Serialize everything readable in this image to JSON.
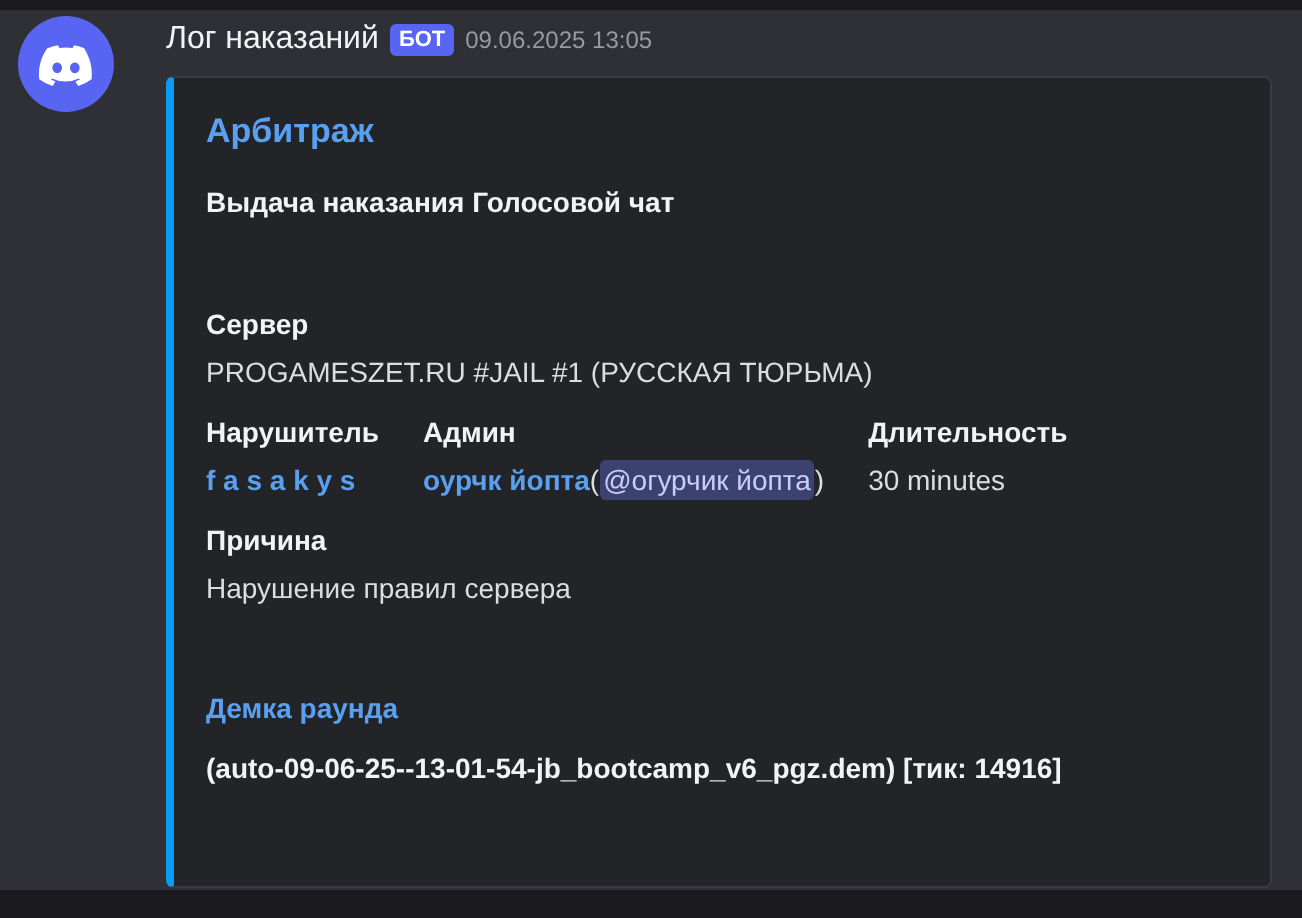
{
  "message": {
    "author": "Лог наказаний",
    "badge": "БОТ",
    "timestamp": "09.06.2025 13:05"
  },
  "embed": {
    "title": "Арбитраж",
    "description": "Выдача наказания Голосовой чат",
    "rows": [
      {
        "kind": "spacer"
      },
      {
        "kind": "fields",
        "fields": [
          {
            "name": "Сервер",
            "name_link": false,
            "values": [
              {
                "kind": "plain",
                "text": "PROGAMESZET.RU #JAIL #1 (РУССКАЯ ТЮРЬМА)"
              }
            ]
          }
        ]
      },
      {
        "kind": "fields",
        "fields": [
          {
            "name": "Нарушитель",
            "name_link": false,
            "values": [
              {
                "kind": "link",
                "text": "f a s a k y s"
              }
            ]
          },
          {
            "name": "Админ",
            "name_link": false,
            "values": [
              {
                "kind": "link",
                "text": "оурчк йопта"
              },
              {
                "kind": "plain",
                "text": "("
              },
              {
                "kind": "mention",
                "text": "@огурчик йопта"
              },
              {
                "kind": "plain",
                "text": ")"
              }
            ]
          },
          {
            "name": "Длительность",
            "name_link": false,
            "values": [
              {
                "kind": "plain",
                "text": "30 minutes"
              }
            ]
          }
        ]
      },
      {
        "kind": "fields",
        "fields": [
          {
            "name": "Причина",
            "name_link": false,
            "values": [
              {
                "kind": "plain",
                "text": "Нарушение правил сервера"
              }
            ]
          }
        ]
      },
      {
        "kind": "spacer"
      },
      {
        "kind": "fields",
        "fields": [
          {
            "name": "Демка раунда",
            "name_link": true,
            "values": [
              {
                "kind": "bold",
                "text": "(auto-09-06-25--13-01-54-jb_bootcamp_v6_pgz.dem) [тик: 14916]"
              }
            ]
          }
        ]
      }
    ]
  }
}
